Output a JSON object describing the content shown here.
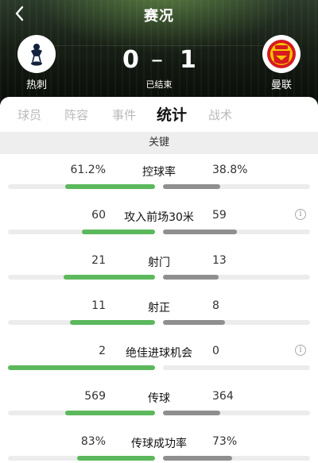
{
  "header": {
    "title": "赛况",
    "status": "已结束",
    "home": {
      "name": "热刺",
      "score": "0"
    },
    "away": {
      "name": "曼联",
      "score": "1"
    },
    "score_separator": "–"
  },
  "tabs": [
    {
      "label": "球员",
      "active": false
    },
    {
      "label": "阵容",
      "active": false
    },
    {
      "label": "事件",
      "active": false
    },
    {
      "label": "统计",
      "active": true
    },
    {
      "label": "战术",
      "active": false
    }
  ],
  "section_label": "关键",
  "colors": {
    "home_bar": "#5cb85c",
    "away_bar": "#8f8f8f",
    "bar_track": "#ececec"
  },
  "stats": [
    {
      "label": "控球率",
      "home": "61.2%",
      "away": "38.8%",
      "home_fill": 0.612,
      "away_fill": 0.388,
      "info": false
    },
    {
      "label": "攻入前场30米",
      "home": "60",
      "away": "59",
      "home_fill": 0.5,
      "away_fill": 0.5,
      "info": true
    },
    {
      "label": "射门",
      "home": "21",
      "away": "13",
      "home_fill": 0.62,
      "away_fill": 0.38,
      "info": false
    },
    {
      "label": "射正",
      "home": "11",
      "away": "8",
      "home_fill": 0.58,
      "away_fill": 0.42,
      "info": false
    },
    {
      "label": "绝佳进球机会",
      "home": "2",
      "away": "0",
      "home_fill": 1.0,
      "away_fill": 0.0,
      "info": true
    },
    {
      "label": "传球",
      "home": "569",
      "away": "364",
      "home_fill": 0.61,
      "away_fill": 0.39,
      "info": false
    },
    {
      "label": "传球成功率",
      "home": "83%",
      "away": "73%",
      "home_fill": 0.53,
      "away_fill": 0.47,
      "info": false
    }
  ],
  "icons": {
    "back": "chevron-left-icon",
    "info": "info-icon",
    "home_logo": "spurs-crest-icon",
    "away_logo": "man-utd-crest-icon"
  }
}
